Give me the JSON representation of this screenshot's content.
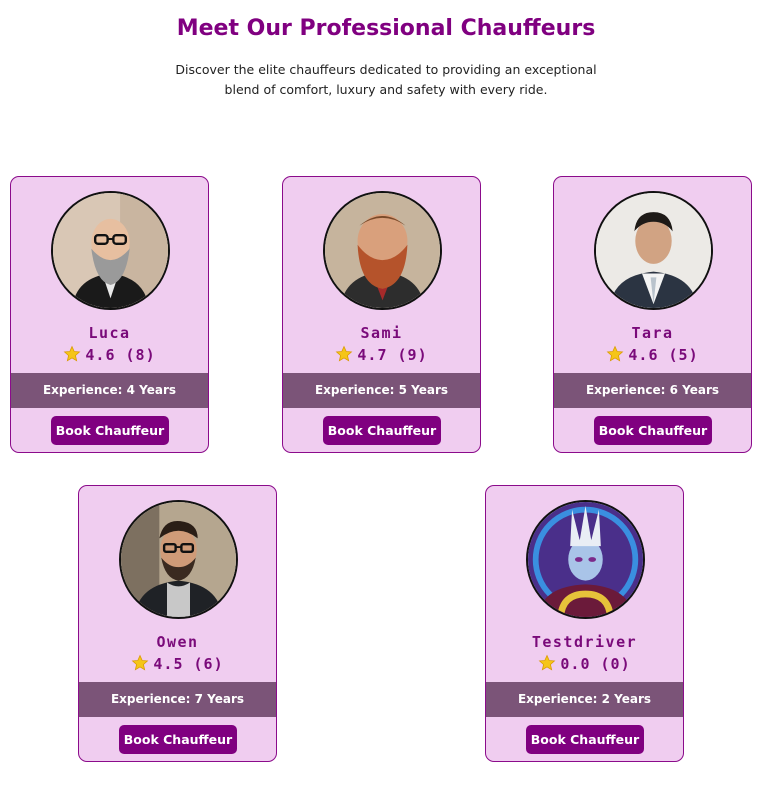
{
  "header": {
    "title": "Meet Our Professional Chauffeurs",
    "subtitle": "Discover the elite chauffeurs dedicated to providing an exceptional blend of comfort, luxury and safety with every ride."
  },
  "chauffeurs": [
    {
      "name": "Luca",
      "rating": "4.6 (8)",
      "experience": "Experience: 4 Years",
      "button": "Book Chauffeur"
    },
    {
      "name": "Sami",
      "rating": "4.7 (9)",
      "experience": "Experience: 5 Years",
      "button": "Book Chauffeur"
    },
    {
      "name": "Tara",
      "rating": "4.6 (5)",
      "experience": "Experience: 6 Years",
      "button": "Book Chauffeur"
    },
    {
      "name": "Owen",
      "rating": "4.5 (6)",
      "experience": "Experience: 7 Years",
      "button": "Book Chauffeur"
    },
    {
      "name": "Testdriver",
      "rating": "0.0 (0)",
      "experience": "Experience: 2 Years",
      "button": "Book Chauffeur"
    }
  ],
  "colors": {
    "accent": "#800080",
    "card_bg": "#f0cdf0",
    "experience_bar": "#7b5478",
    "star": "#f5c518"
  },
  "icons": {
    "rating": "star-icon"
  }
}
